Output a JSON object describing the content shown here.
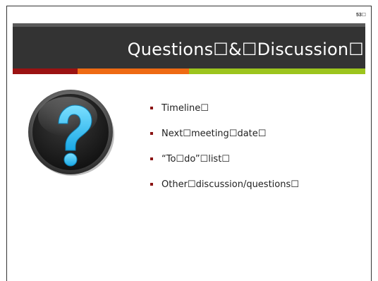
{
  "slide": {
    "page_number": "53☐",
    "title": "Questions☐&☐Discussion☐",
    "accent_colors": {
      "red": "#9b1212",
      "orange": "#ee6a13",
      "green": "#9cc41d",
      "title_bar": "#333333"
    },
    "icon": "question-mark-icon",
    "bullets": [
      {
        "label": "Timeline☐"
      },
      {
        "label": "Next☐meeting☐date☐"
      },
      {
        "label": "“To☐do”☐list☐"
      },
      {
        "label": "Other☐discussion/questions☐"
      }
    ]
  }
}
